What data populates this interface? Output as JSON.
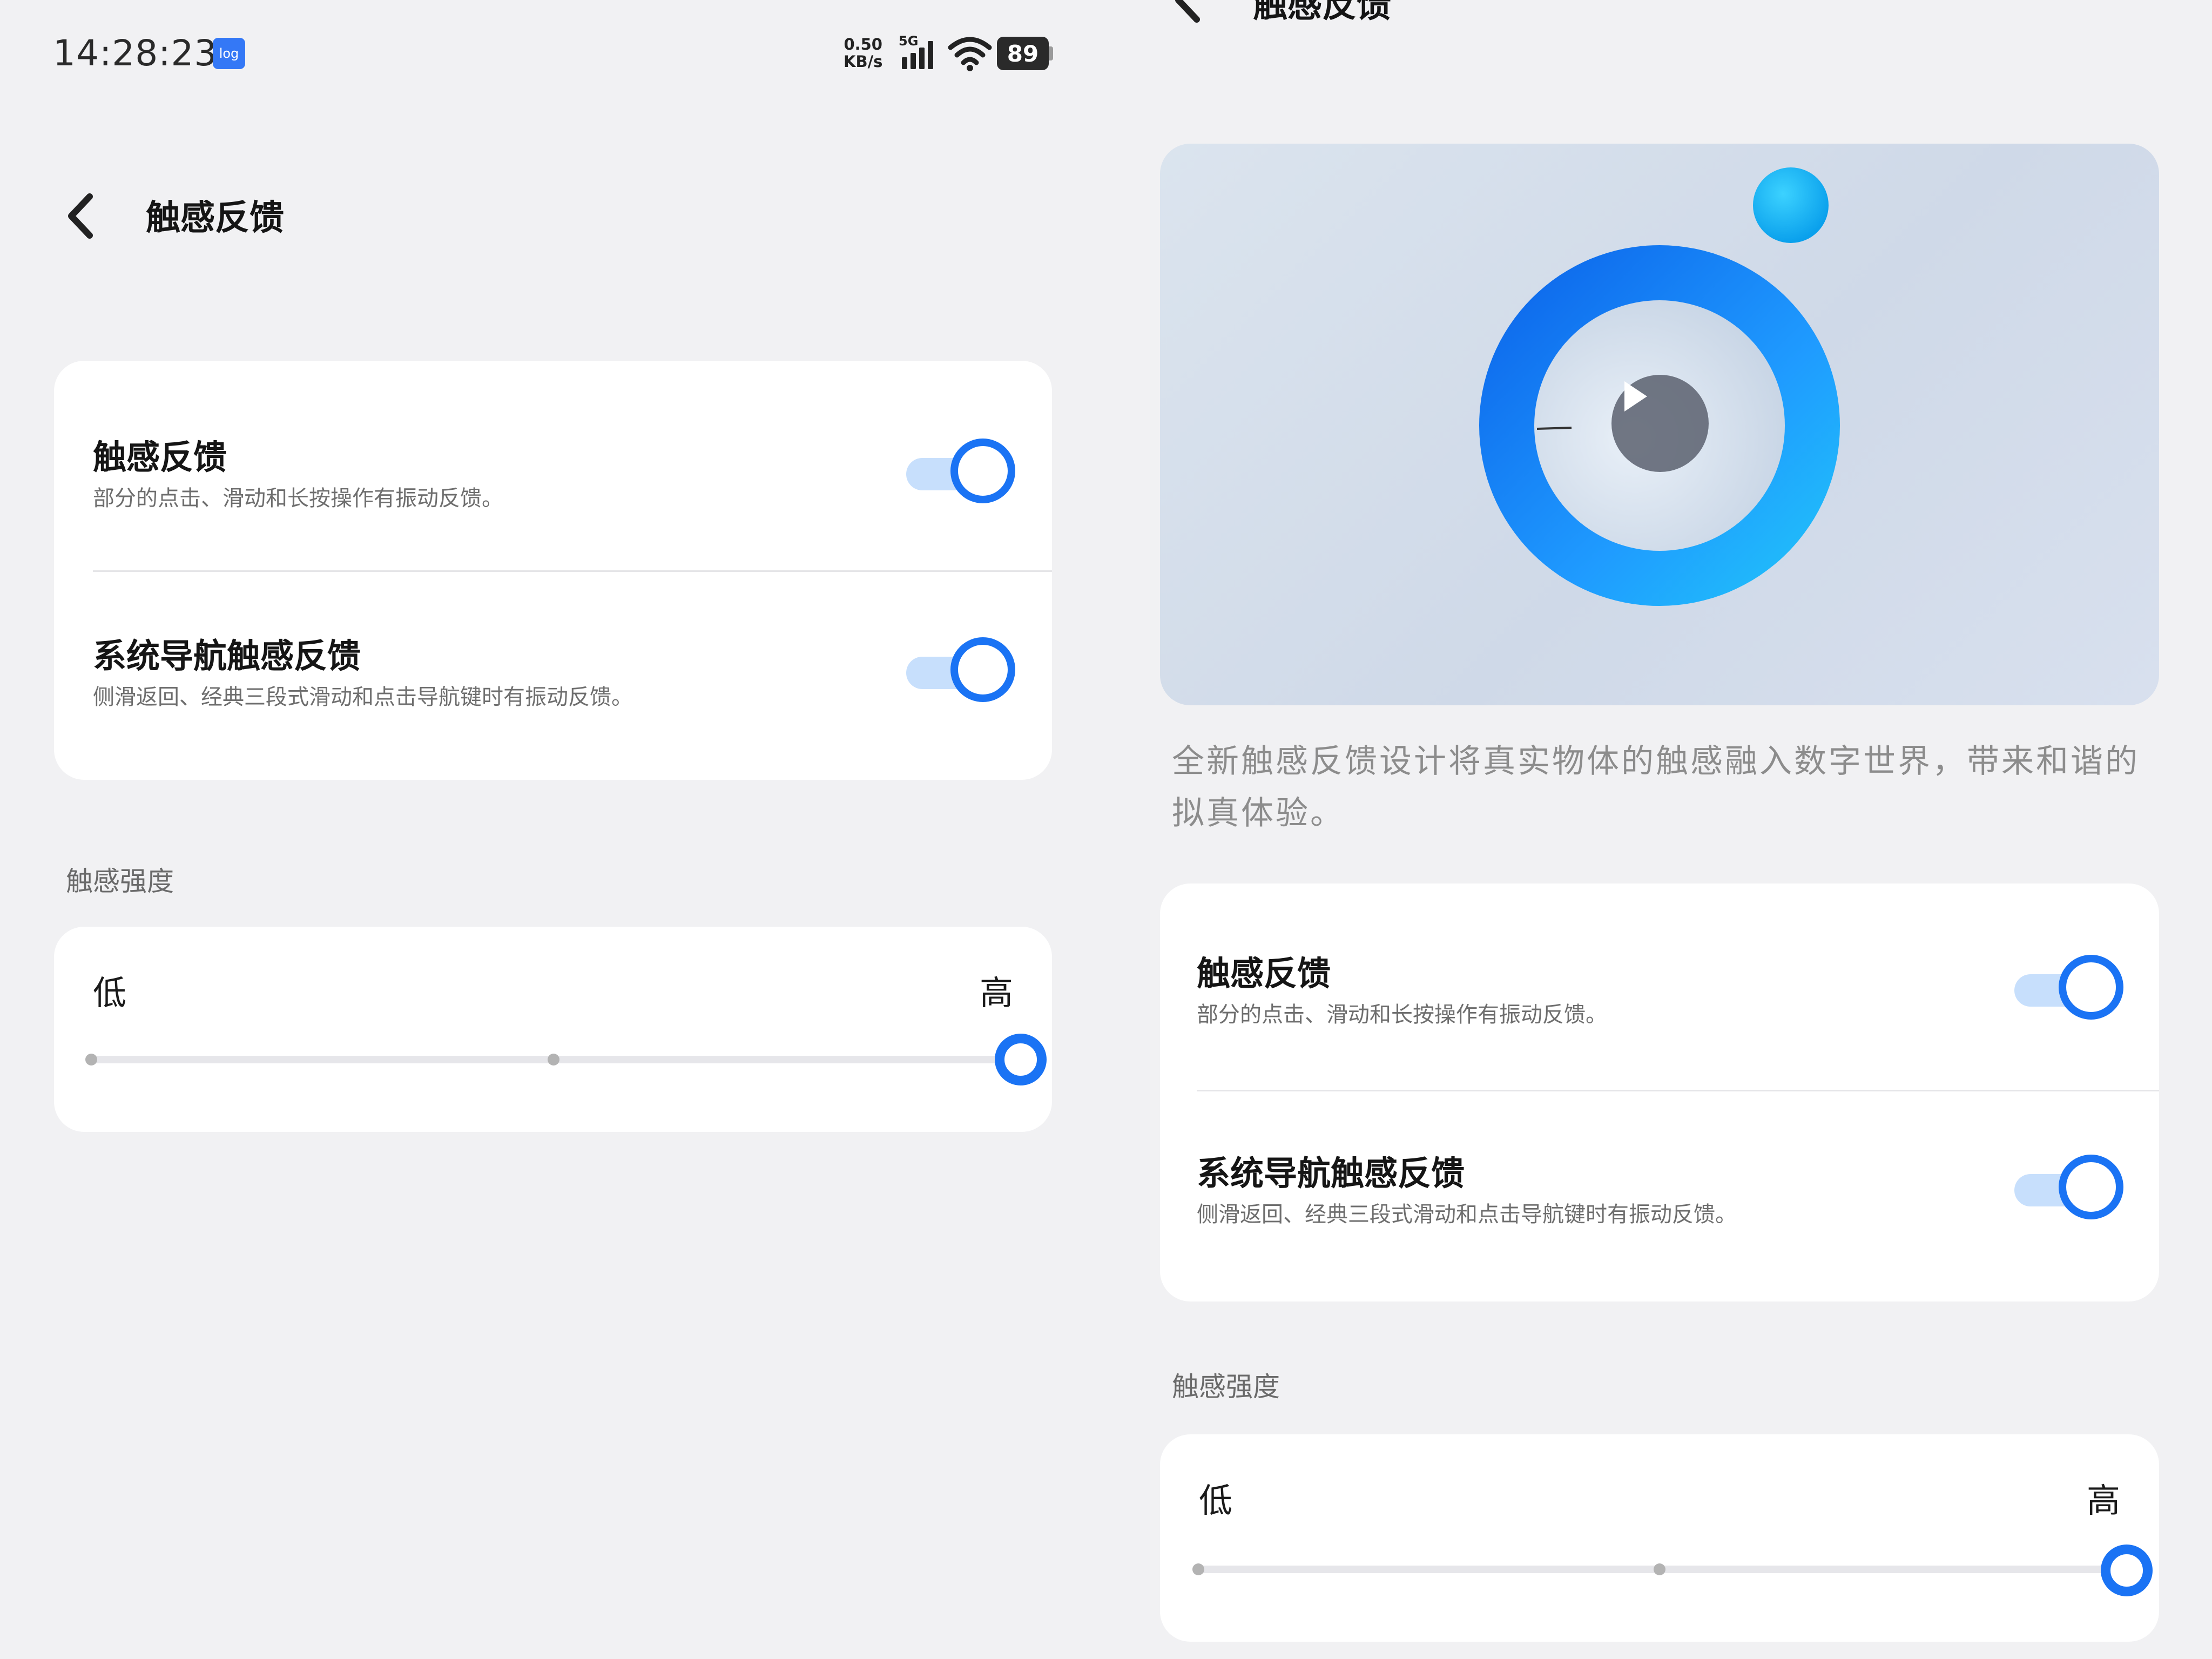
{
  "status_bar": {
    "time": "14:28:23",
    "log_badge": "log",
    "net_speed_value": "0.50",
    "net_speed_unit": "KB/s",
    "network_type": "5G",
    "battery_level": "89",
    "icons": [
      "cellular-signal-icon",
      "wifi-icon",
      "battery-icon"
    ]
  },
  "left_pane": {
    "page_title": "触感反馈",
    "settings": [
      {
        "title": "触感反馈",
        "description": "部分的点击、滑动和长按操作有振动反馈。",
        "enabled": true
      },
      {
        "title": "系统导航触感反馈",
        "description": "侧滑返回、经典三段式滑动和点击导航键时有振动反馈。",
        "enabled": true
      }
    ],
    "intensity_section_label": "触感强度",
    "intensity": {
      "low_label": "低",
      "high_label": "高",
      "level_fraction": 1.0,
      "steps": 3
    }
  },
  "right_pane": {
    "page_title": "触感反馈",
    "video_caption": "全新触感反馈设计将真实物体的触感融入数字世界，带来和谐的拟真体验。",
    "settings": [
      {
        "title": "触感反馈",
        "description": "部分的点击、滑动和长按操作有振动反馈。",
        "enabled": true
      },
      {
        "title": "系统导航触感反馈",
        "description": "侧滑返回、经典三段式滑动和点击导航键时有振动反馈。",
        "enabled": true
      }
    ],
    "intensity_section_label": "触感强度",
    "intensity": {
      "low_label": "低",
      "high_label": "高",
      "level_fraction": 1.0,
      "steps": 3
    }
  },
  "colors": {
    "accent": "#1a73f4",
    "toggle_track": "#c7dffc",
    "background": "#f1f1f3",
    "card": "#ffffff"
  }
}
